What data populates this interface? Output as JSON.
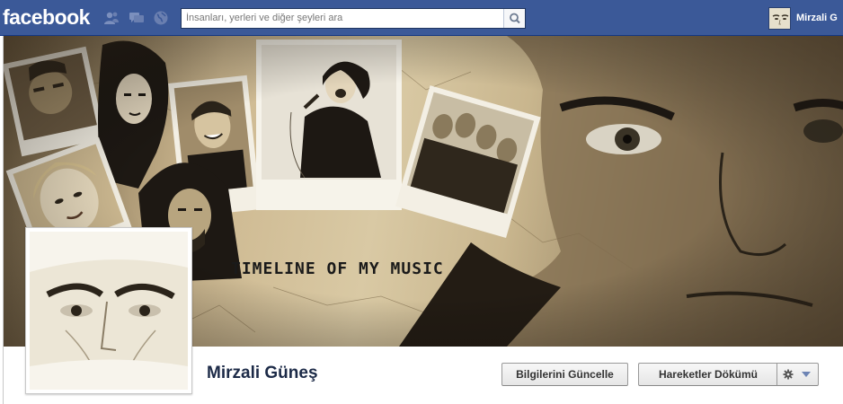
{
  "topbar": {
    "logo": "facebook",
    "search_placeholder": "İnsanları, yerleri ve diğer şeyleri ara",
    "user_name": "Mirzali G",
    "bg_color": "#3b5998"
  },
  "cover": {
    "caption": "TIMELINE OF MY MUSIC"
  },
  "profile": {
    "name": "Mirzali Güneş"
  },
  "actions": {
    "update_info_label": "Bilgilerini Güncelle",
    "activity_log_label": "Hareketler Dökümü"
  },
  "icons": {
    "friend_requests": "friend-requests-icon",
    "messages": "messages-icon",
    "notifications": "notifications-globe-icon",
    "search": "search-icon",
    "gear": "gear-icon",
    "chevron": "chevron-down-icon"
  }
}
